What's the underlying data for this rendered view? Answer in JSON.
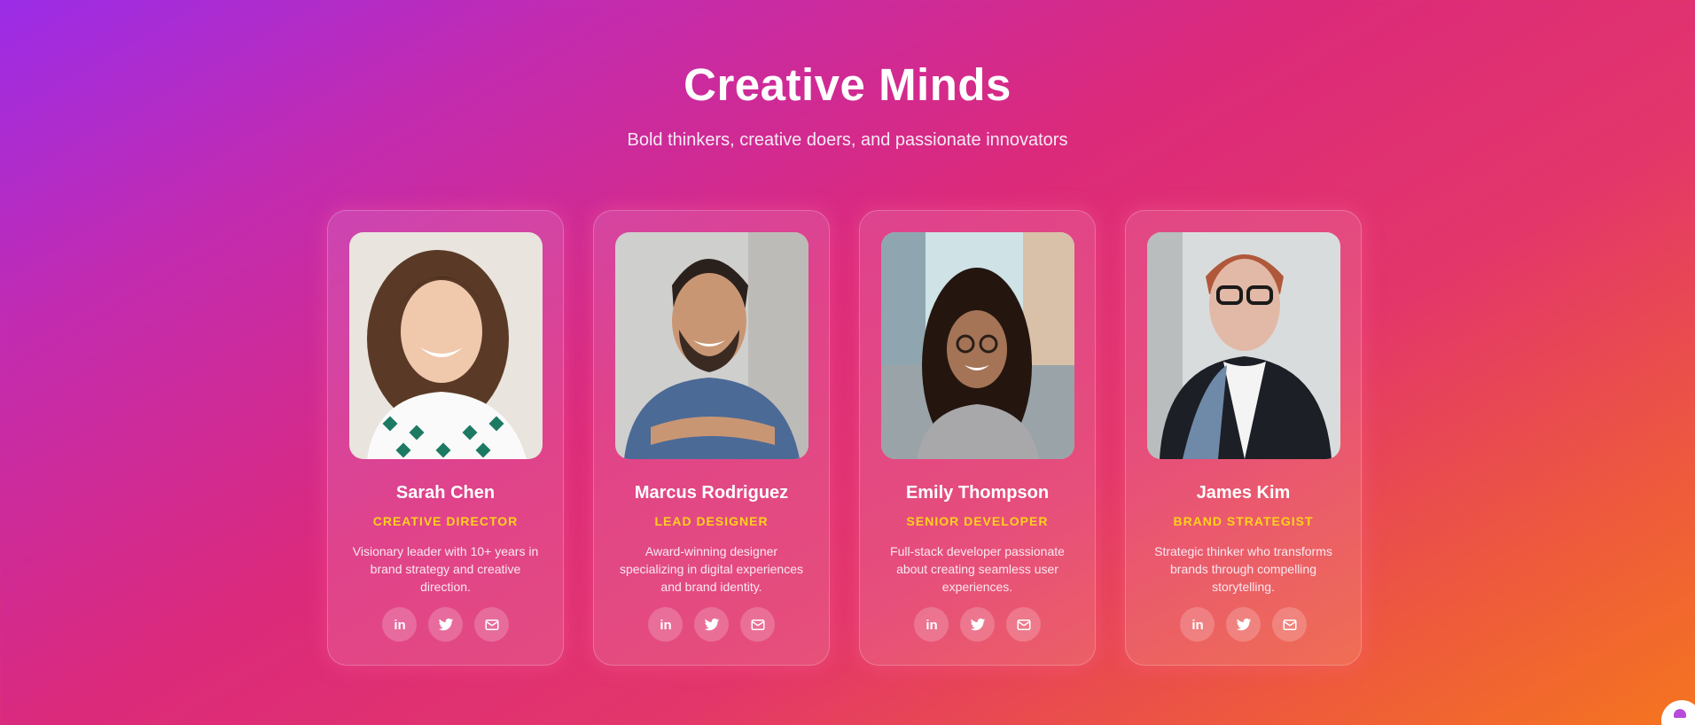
{
  "header": {
    "title": "Creative Minds",
    "subtitle": "Bold thinkers, creative doers, and passionate innovators"
  },
  "team": [
    {
      "name": "Sarah Chen",
      "role": "CREATIVE DIRECTOR",
      "bio": "Visionary leader with 10+ years in brand strategy and creative direction.",
      "photo": "portrait-woman-curly-hair"
    },
    {
      "name": "Marcus Rodriguez",
      "role": "LEAD DESIGNER",
      "bio": "Award-winning designer specializing in digital experiences and brand identity.",
      "photo": "portrait-man-blue-tshirt"
    },
    {
      "name": "Emily Thompson",
      "role": "SENIOR DEVELOPER",
      "bio": "Full-stack developer passionate about creating seamless user experiences.",
      "photo": "portrait-woman-glasses-street"
    },
    {
      "name": "James Kim",
      "role": "BRAND STRATEGIST",
      "bio": "Strategic thinker who transforms brands through compelling storytelling.",
      "photo": "portrait-man-glasses-suit"
    }
  ],
  "social_icons": [
    "linkedin-icon",
    "twitter-icon",
    "email-icon"
  ],
  "colors": {
    "role_accent": "#ffd21a",
    "background_start": "#9b2ce8",
    "background_mid": "#dc2a7a",
    "background_end": "#f5751f"
  }
}
